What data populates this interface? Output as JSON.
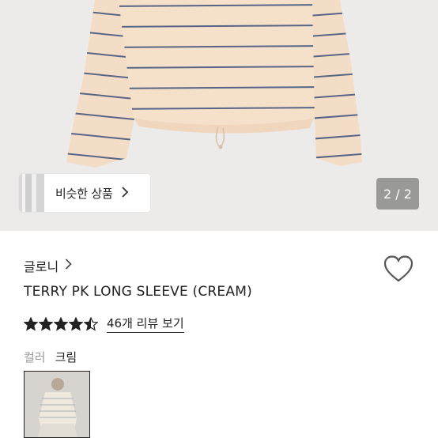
{
  "gallery": {
    "similar_products_label": "비슷한 상품",
    "page_counter": "2 / 2",
    "colors": {
      "background": "#ecebea",
      "garment": "#f3ddc6",
      "stripe": "#3b4f7a"
    }
  },
  "product": {
    "brand": "글로니",
    "title": "TERRY PK LONG SLEEVE (CREAM)",
    "rating": 4.5,
    "review_link": "46개 리뷰 보기",
    "option_label": "컬러",
    "option_value": "크림"
  },
  "icons": {
    "brand_chevron": "chevron-right-icon",
    "wishlist": "heart-outline-icon",
    "star": "star-icon"
  }
}
